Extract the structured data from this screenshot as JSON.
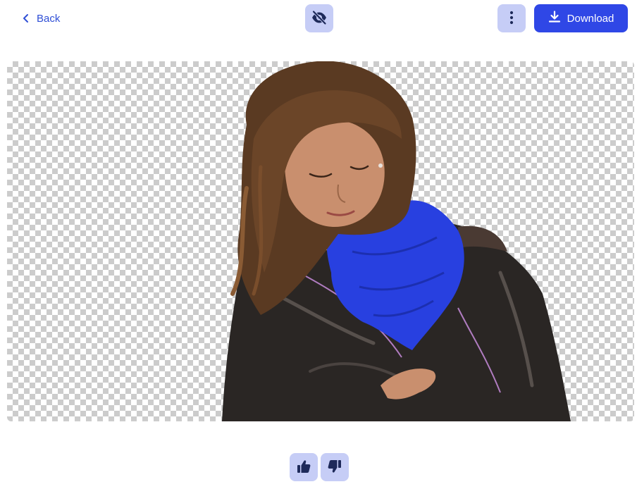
{
  "header": {
    "back_label": "Back",
    "download_label": "Download"
  },
  "icons": {
    "back": "chevron-left-icon",
    "toggle_preview": "eye-off-icon",
    "more": "more-vertical-icon",
    "download": "download-icon",
    "thumbs_up": "thumbs-up-icon",
    "thumbs_down": "thumbs-down-icon"
  },
  "colors": {
    "accent": "#2f47e6",
    "accent_soft": "#c6cdf6",
    "icon_dark": "#1e2a5a",
    "scarf": "#2840e0",
    "jacket": "#2a2624",
    "hair": "#5a3a22",
    "skin": "#c98f6e",
    "jeans": "#3f6ea8"
  },
  "image": {
    "description_kind": "background-removed-photo",
    "background": "transparent-checkerboard"
  }
}
